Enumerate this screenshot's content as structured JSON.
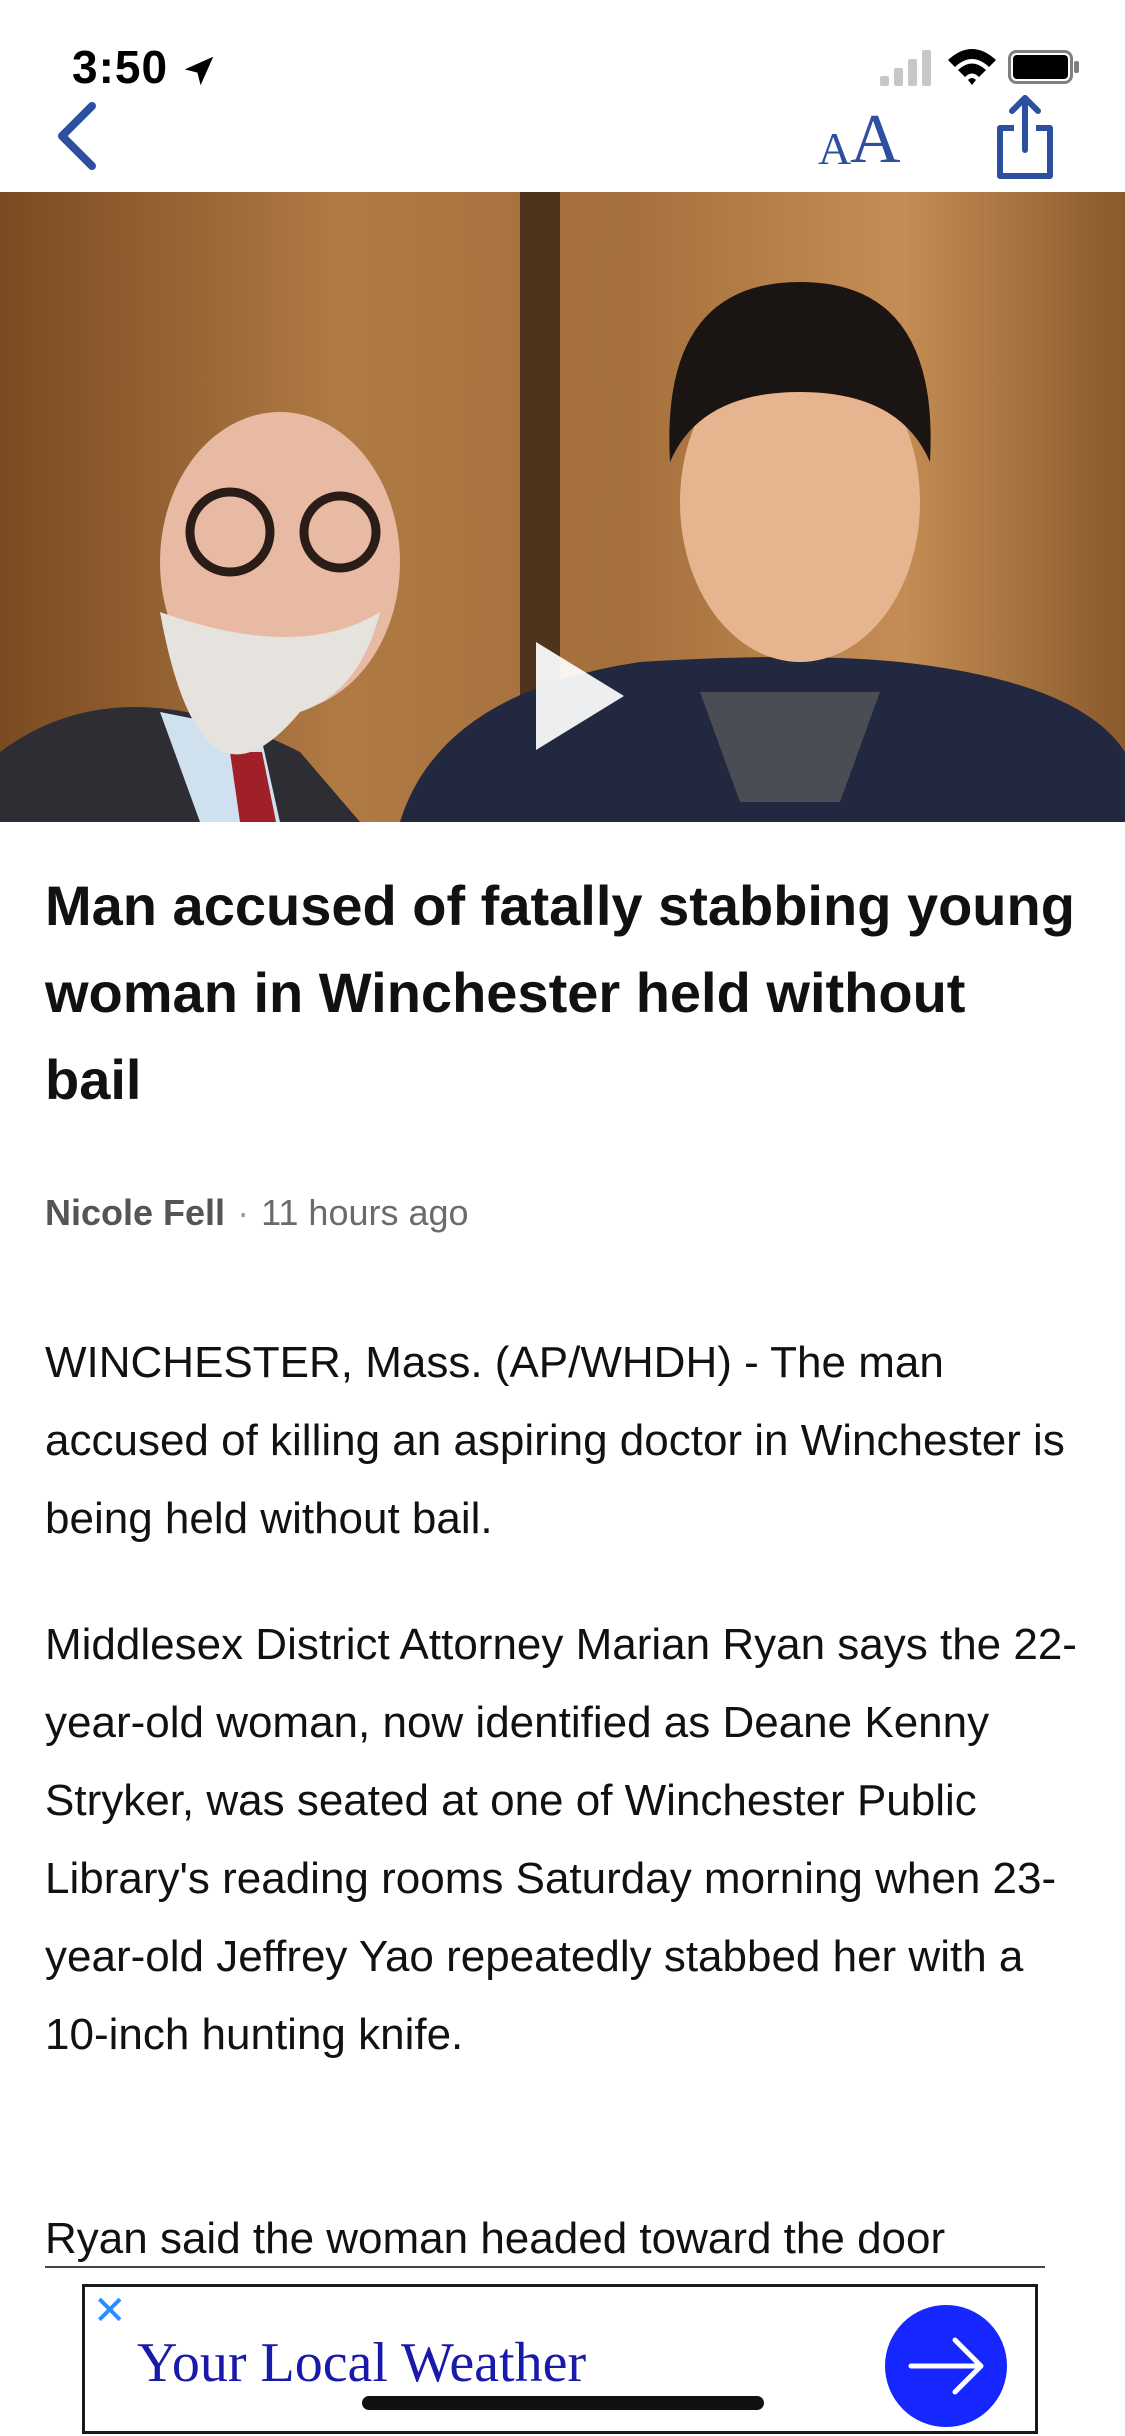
{
  "status_bar": {
    "time": "3:50"
  },
  "nav": {
    "text_size_small": "A",
    "text_size_large": "A"
  },
  "video": {
    "state": "paused"
  },
  "article": {
    "headline": "Man accused of fatally stabbing young woman in Winchester held without bail",
    "author": "Nicole Fell",
    "separator": "·",
    "timestamp": "11 hours ago",
    "paragraphs": [
      "WINCHESTER, Mass. (AP/WHDH) - The man accused of killing an aspiring doctor in Winchester is being held without bail.",
      "Middlesex District Attorney Marian Ryan says the 22-year-old woman, now identified as Deane Kenny Stryker, was seated at one of Winchester Public Library's reading rooms Saturday morning when 23-year-old Jeffrey Yao repeatedly stabbed her with a 10-inch hunting knife.",
      "Ryan said the woman headed toward the door"
    ]
  },
  "ad": {
    "close": "✕",
    "text": "Your Local Weather"
  },
  "colors": {
    "accent": "#2c4fa0",
    "ad_button": "#1626ff",
    "ad_text": "#1a1aaa"
  }
}
